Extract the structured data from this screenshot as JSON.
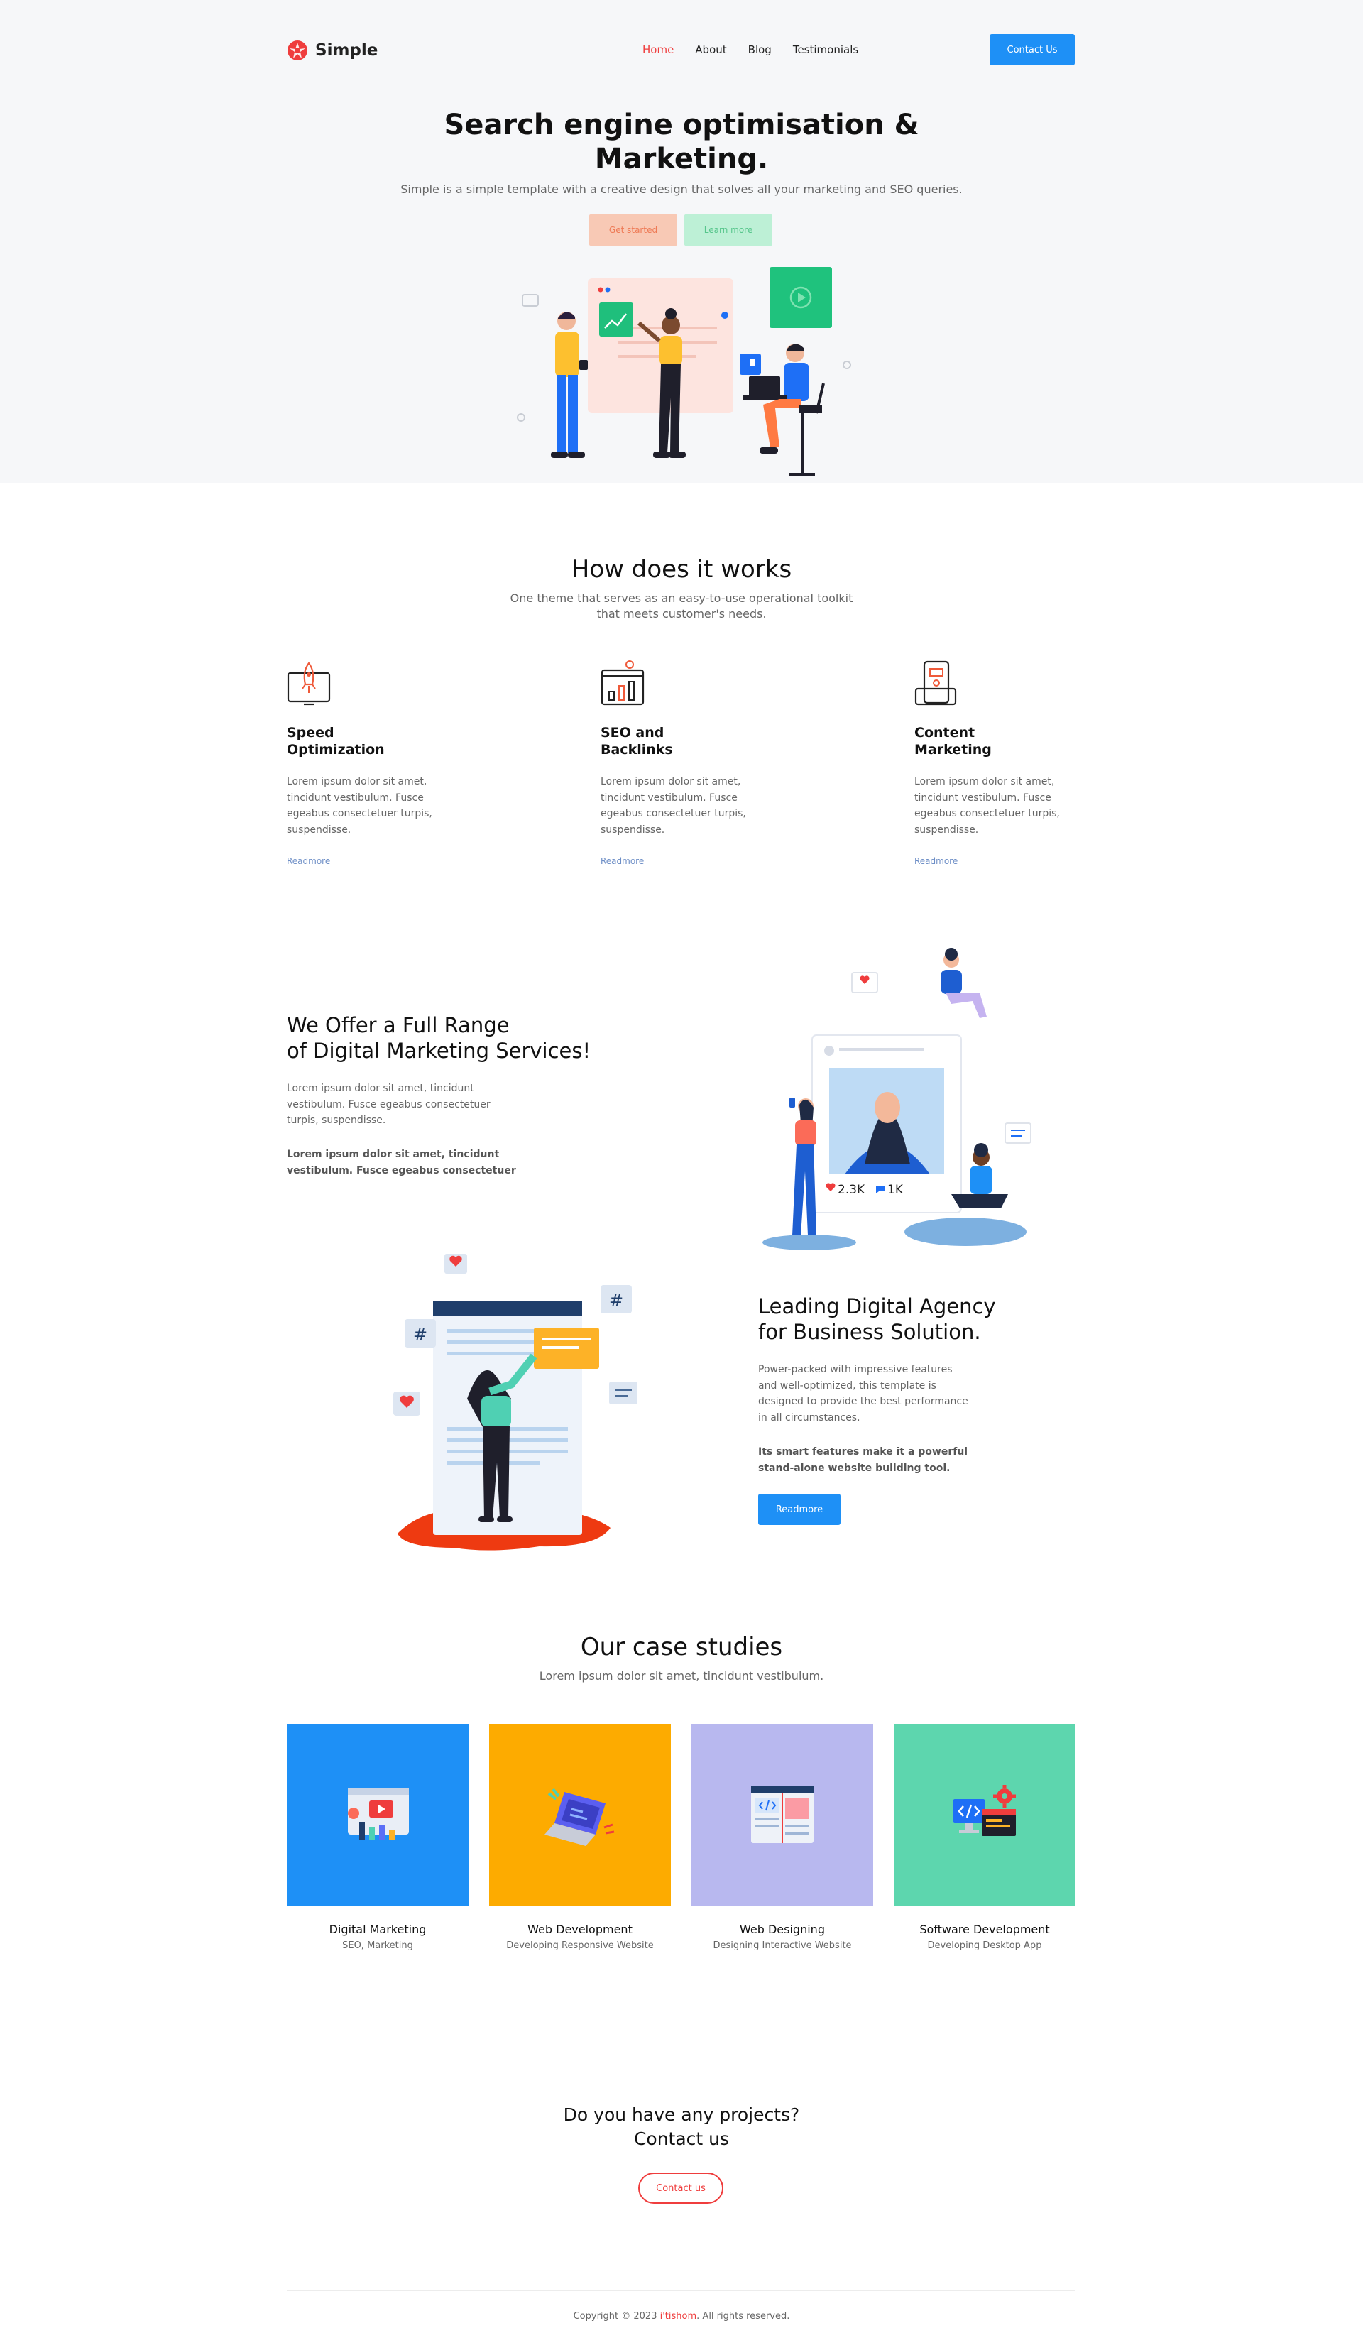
{
  "header": {
    "logo_text": "Simple",
    "nav": [
      "Home",
      "About",
      "Blog",
      "Testimonials"
    ],
    "contact_button": "Contact Us"
  },
  "hero": {
    "title_line1": "Search engine optimisation &",
    "title_line2": "Marketing.",
    "subtitle": "Simple is a simple template with a creative design that solves all your marketing and SEO queries.",
    "get_started": "Get started",
    "learn_more": "Learn more"
  },
  "how": {
    "title": "How does it works",
    "subtitle_line1": "One theme that serves as an easy-to-use operational toolkit",
    "subtitle_line2": "that meets customer's needs.",
    "features": [
      {
        "icon": "rocket-monitor-icon",
        "title": "Speed Optimization",
        "text": "Lorem ipsum dolor sit amet, tincidunt vestibulum. Fusce egeabus consectetuer turpis, suspendisse.",
        "more": "Readmore"
      },
      {
        "icon": "seo-chart-icon",
        "title": "SEO and Backlinks",
        "text": "Lorem ipsum dolor sit amet, tincidunt vestibulum. Fusce egeabus consectetuer turpis, suspendisse.",
        "more": "Readmore"
      },
      {
        "icon": "content-phone-icon",
        "title": "Content Marketing",
        "text": "Lorem ipsum dolor sit amet, tincidunt vestibulum. Fusce egeabus consectetuer turpis, suspendisse.",
        "more": "Readmore"
      }
    ]
  },
  "offer": {
    "title_line1": "We Offer a Full Range",
    "title_line2": "of Digital Marketing Services!",
    "text": "Lorem ipsum dolor sit amet, tincidunt vestibulum. Fusce egeabus consectetuer turpis, suspendisse.",
    "bold": "Lorem ipsum dolor sit amet, tincidunt vestibulum. Fusce egeabus consectetuer",
    "likes": "2.3K",
    "comments": "1K"
  },
  "agency": {
    "title_line1": "Leading Digital Agency",
    "title_line2": "for Business Solution.",
    "text": "Power-packed with impressive features and well-optimized, this template is designed to provide the best performance in all circumstances.",
    "bold": "Its smart features make it a powerful stand-alone website building tool.",
    "button": "Readmore"
  },
  "cases": {
    "title": "Our case studies",
    "subtitle": "Lorem ipsum dolor sit amet, tincidunt vestibulum.",
    "items": [
      {
        "title": "Digital Marketing",
        "sub": "SEO, Marketing",
        "color": "#1e90f6",
        "icon": "video-analytics-icon"
      },
      {
        "title": "Web Development",
        "sub": "Developing Responsive Website",
        "color": "#fdab00",
        "icon": "laptop-code-icon"
      },
      {
        "title": "Web Designing",
        "sub": "Designing Interactive Website",
        "color": "#b8b8ef",
        "icon": "web-layout-icon"
      },
      {
        "title": "Software Development",
        "sub": "Developing Desktop App",
        "color": "#5dd6ae",
        "icon": "desktop-gear-icon"
      }
    ]
  },
  "contact": {
    "line1": "Do you have any projects?",
    "line2": "Contact us",
    "button": "Contact us"
  },
  "footer": {
    "prefix": "Copyright © 2023 ",
    "brand": "i'tishom",
    "suffix": ". All rights reserved."
  },
  "colors": {
    "accent": "#1e90f6",
    "brand_red": "#ef3d3d",
    "hero_bg": "#f6f7f9"
  }
}
